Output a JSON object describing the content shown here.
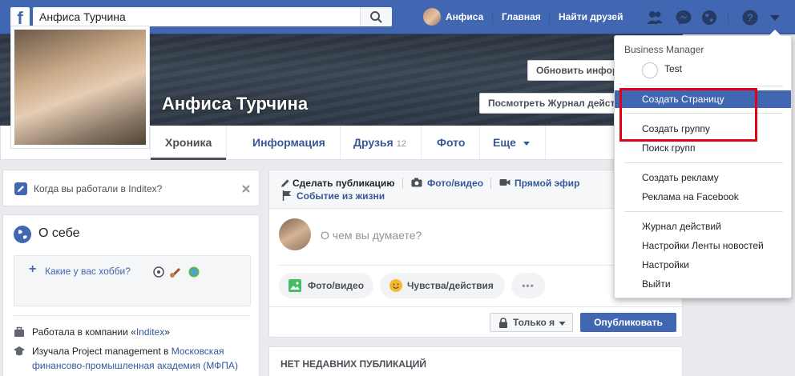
{
  "topbar": {
    "search_value": "Анфиса Турчина",
    "profile_name": "Анфиса",
    "home_label": "Главная",
    "find_friends_label": "Найти друзей",
    "brand_color": "#4267b2"
  },
  "cover": {
    "update_info_label": "Обновить информацию",
    "activity_log_label": "Посмотреть Журнал действий"
  },
  "profile": {
    "name": "Анфиса Турчина"
  },
  "tabs": [
    {
      "label": "Хроника"
    },
    {
      "label": "Информация"
    },
    {
      "label": "Друзья",
      "count": "12"
    },
    {
      "label": "Фото"
    },
    {
      "label": "Еще"
    }
  ],
  "left": {
    "hint_text": "Когда вы работали в Inditex?",
    "about_title": "О себе",
    "hobby_prompt": "Какие у вас хобби?",
    "work_prefix": "Работала в компании «",
    "work_company": "Inditex",
    "work_suffix": "»",
    "study_prefix": "Изучала Project management в ",
    "study_school": "Московская финансово-промышленная академия (МФПА)"
  },
  "composer": {
    "create_post": "Сделать публикацию",
    "photo_video": "Фото/видео",
    "live": "Прямой эфир",
    "life_event": "Событие из жизни",
    "placeholder": "О чем вы думаете?",
    "pill_photo": "Фото/видео",
    "pill_feelings": "Чувства/действия",
    "pill_more": "•••",
    "privacy": "Только я",
    "publish": "Опубликовать"
  },
  "recent": {
    "title": "НЕТ НЕДАВНИХ ПУБЛИКАЦИЙ"
  },
  "dropdown": {
    "header": "Business Manager",
    "test_label": "Test",
    "items": [
      "Создать Страницу",
      "Создать группу",
      "Поиск групп",
      "Создать рекламу",
      "Реклама на Facebook",
      "Журнал действий",
      "Настройки Ленты новостей",
      "Настройки",
      "Выйти"
    ],
    "highlight_color": "#4267b2",
    "annotation_color": "#e2001a"
  }
}
